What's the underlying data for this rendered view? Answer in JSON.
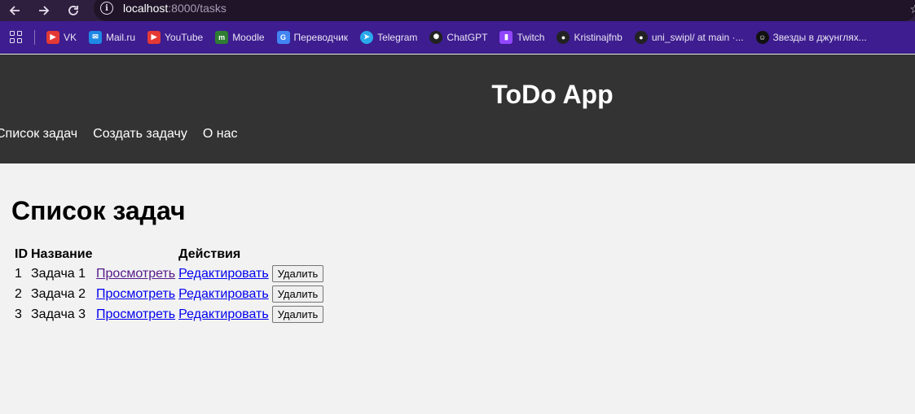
{
  "browser": {
    "url_host": "localhost",
    "url_path": ":8000/tasks",
    "bookmarks": [
      {
        "label": "VK",
        "icon": "youtube-red-icon",
        "color": "#e53935"
      },
      {
        "label": "Mail.ru",
        "icon": "mail-icon",
        "color": "#1e88e5"
      },
      {
        "label": "YouTube",
        "icon": "youtube-icon",
        "color": "#e53935"
      },
      {
        "label": "Moodle",
        "icon": "moodle-icon",
        "color": "#2e7d32"
      },
      {
        "label": "Переводчик",
        "icon": "translate-icon",
        "color": "#4285f4"
      },
      {
        "label": "Telegram",
        "icon": "telegram-icon",
        "color": "#29a9eb"
      },
      {
        "label": "ChatGPT",
        "icon": "chatgpt-icon",
        "color": "#222222"
      },
      {
        "label": "Twitch",
        "icon": "twitch-icon",
        "color": "#9146ff"
      },
      {
        "label": "Kristinajfnb",
        "icon": "github-icon",
        "color": "#222222"
      },
      {
        "label": "uni_swipl/ at main ·...",
        "icon": "github-icon",
        "color": "#222222"
      },
      {
        "label": "Звезды в джунглях...",
        "icon": "avatar-icon",
        "color": "#111111"
      }
    ]
  },
  "header": {
    "title": "ToDo App",
    "nav": [
      "Список задач",
      "Создать задачу",
      "О нас"
    ]
  },
  "main": {
    "heading": "Список задач",
    "columns": [
      "ID",
      "Название",
      "",
      "Действия",
      ""
    ],
    "rows": [
      {
        "id": "1",
        "name": "Задача 1",
        "view": "Просмотреть",
        "edit": "Редактировать",
        "delete": "Удалить"
      },
      {
        "id": "2",
        "name": "Задача 2",
        "view": "Просмотреть",
        "edit": "Редактировать",
        "delete": "Удалить"
      },
      {
        "id": "3",
        "name": "Задача 3",
        "view": "Просмотреть",
        "edit": "Редактировать",
        "delete": "Удалить"
      }
    ]
  },
  "colors": {
    "header_bg": "#333333",
    "page_bg": "#f2f2f2",
    "link": "#0000ee",
    "link_visited": "#551a8b",
    "bookmarks_bar": "#3d1d8f"
  }
}
